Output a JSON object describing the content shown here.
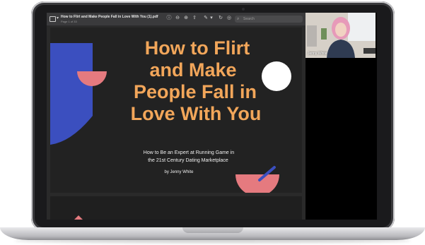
{
  "viewer": {
    "document_title": "How to Flirt and Make People Fall in Love With You (1).pdf",
    "page_info": "Page 1 of 33",
    "search_placeholder": "Search"
  },
  "slide": {
    "title_lines": [
      "How to Flirt",
      "and Make",
      "People Fall in",
      "Love With You"
    ],
    "subtitle_lines": [
      "How to Be an Expert at Running Game in",
      "the 21st Century Dating Marketplace"
    ],
    "author": "by Jenny White"
  },
  "video": {
    "participant_name": "Jenny White"
  },
  "colors": {
    "title_accent": "#f2a65a",
    "shape_blue": "#3b4fbf",
    "shape_pink": "#e57a7f",
    "slide_background": "#222222"
  }
}
